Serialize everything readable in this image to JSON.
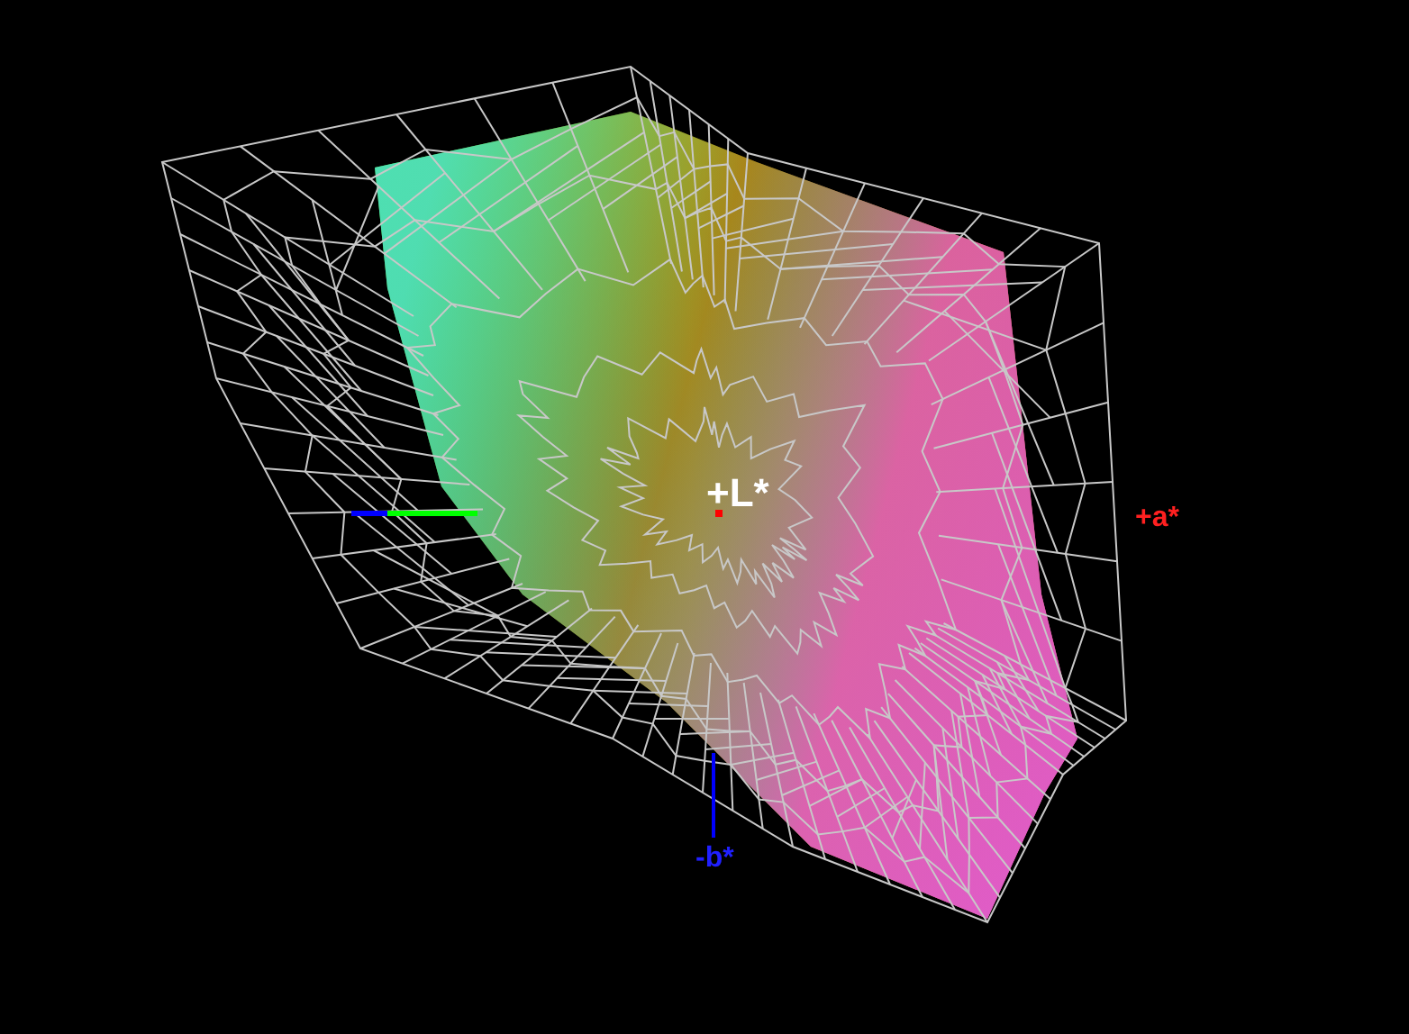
{
  "view": {
    "axis_labels": [
      {
        "text": "+L*",
        "kind": "lightness"
      },
      {
        "text": "+a*",
        "kind": "a"
      },
      {
        "text": "-b*",
        "kind": "b"
      }
    ]
  }
}
